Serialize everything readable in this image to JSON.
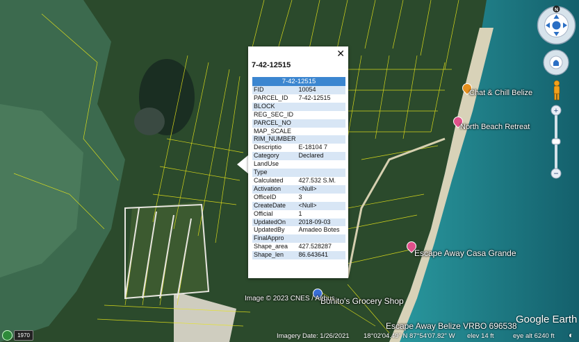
{
  "popup": {
    "title": "7-42-12515",
    "table_header": "7-42-12515",
    "rows": [
      {
        "key": "FID",
        "value": "10054"
      },
      {
        "key": "PARCEL_ID",
        "value": "7-42-12515"
      },
      {
        "key": "BLOCK",
        "value": ""
      },
      {
        "key": "REG_SEC_ID",
        "value": ""
      },
      {
        "key": "PARCEL_NO",
        "value": ""
      },
      {
        "key": "MAP_SCALE",
        "value": ""
      },
      {
        "key": "RIM_NUMBER",
        "value": ""
      },
      {
        "key": "Descriptio",
        "value": "E-18104 7"
      },
      {
        "key": "Category",
        "value": "Declared"
      },
      {
        "key": "LandUse",
        "value": ""
      },
      {
        "key": "Type",
        "value": ""
      },
      {
        "key": "Calculated",
        "value": "427.532 S.M."
      },
      {
        "key": "Activation",
        "value": "<Null>"
      },
      {
        "key": "OfficeID",
        "value": "3"
      },
      {
        "key": "CreateDate",
        "value": "<Null>"
      },
      {
        "key": "Official",
        "value": "1"
      },
      {
        "key": "UpdatedOn",
        "value": "2018-09-03"
      },
      {
        "key": "UpdatedBy",
        "value": "Amadeo Botes"
      },
      {
        "key": "FinalAppro",
        "value": ""
      },
      {
        "key": "Shape_area",
        "value": "427.528287"
      },
      {
        "key": "Shape_len",
        "value": "86.643641"
      }
    ],
    "close_glyph": "✕"
  },
  "places": {
    "chat_chill": "Chat & Chill Belize",
    "north_beach": "North Beach Retreat",
    "escape_away_casa": "Escape Away Casa Grande",
    "bonitos": "Bonito's Grocery Shop",
    "escape_away_vrbo": "Escape Away Belize VRBO 696538"
  },
  "attribution": "Image © 2023 CNES / Airbus",
  "status": {
    "imagery_date": "Imagery Date: 1/26/2021",
    "coords": "18°02'04.49\" N    87°54'07.82\" W",
    "elev": "elev     14 ft",
    "eye_alt": "eye alt   6240 ft"
  },
  "historical_year": "1970",
  "logo": "Google Earth",
  "compass_north": "N",
  "colors": {
    "parcel_line": "#e8e61a",
    "popup_header": "#3b86d0",
    "row_alt": "#d8e6f5",
    "sea": "#1f7f86",
    "land": "#274a2a"
  }
}
